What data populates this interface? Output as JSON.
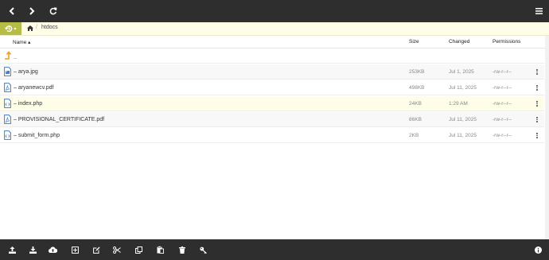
{
  "topbar": {
    "back_icon": "chevron-left-icon",
    "forward_icon": "chevron-right-icon",
    "refresh_icon": "refresh-icon",
    "menu_icon": "hamburger-menu-icon"
  },
  "breadcrumb": {
    "mode_icon": "history-icon",
    "home_icon": "home-icon",
    "separator": "/",
    "current": "htdocs"
  },
  "table": {
    "headers": {
      "name": "Name ▴",
      "size": "Size",
      "changed": "Changed",
      "permissions": "Permissions"
    },
    "rows": [
      {
        "name": "..",
        "size": "",
        "changed": "",
        "permissions": "",
        "icon": "parent-folder-icon"
      },
      {
        "name": "– arya.jpg",
        "size": "253KB",
        "changed": "Jul 1, 2025",
        "permissions": "-rw-r--r--",
        "icon": "image-file-icon"
      },
      {
        "name": "– aryanewcv.pdf",
        "size": "498KB",
        "changed": "Jul 11, 2025",
        "permissions": "-rw-r--r--",
        "icon": "pdf-file-icon"
      },
      {
        "name": "– index.php",
        "size": "24KB",
        "changed": "1:29 AM",
        "permissions": "-rw-r--r--",
        "icon": "code-file-icon"
      },
      {
        "name": "– PROVISIONAL_CERTIFICATE.pdf",
        "size": "86KB",
        "changed": "Jul 11, 2025",
        "permissions": "-rw-r--r--",
        "icon": "pdf-file-icon"
      },
      {
        "name": "– submit_form.php",
        "size": "2KB",
        "changed": "Jul 11, 2025",
        "permissions": "-rw-r--r--",
        "icon": "code-file-icon"
      }
    ]
  },
  "toolbar": {
    "icons": [
      "upload-icon",
      "download-icon",
      "cloud-upload-icon",
      "new-file-icon",
      "edit-icon",
      "cut-icon",
      "copy-icon",
      "paste-icon",
      "delete-icon",
      "permissions-key-icon",
      "info-icon"
    ]
  },
  "colors": {
    "bar": "#2e2e2e",
    "accent": "#b5bd47",
    "highlight": "#fdfde8",
    "folder_up": "#f0a020",
    "file_icon": "#3f7fc3"
  }
}
